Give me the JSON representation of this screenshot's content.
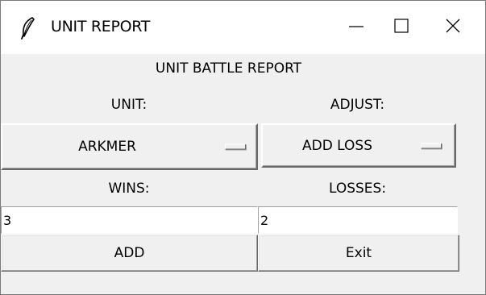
{
  "window": {
    "title": "UNIT REPORT",
    "icon": "feather-icon"
  },
  "controls": {
    "minimize_icon": "minimize-icon",
    "maximize_icon": "maximize-icon",
    "close_icon": "close-icon"
  },
  "header": {
    "title": "UNIT BATTLE REPORT"
  },
  "unit": {
    "label": "UNIT:",
    "selected": "ARKMER"
  },
  "adjust": {
    "label": "ADJUST:",
    "selected": "ADD LOSS"
  },
  "wins": {
    "label": "WINS:",
    "value": "3"
  },
  "losses": {
    "label": "LOSSES:",
    "value": "2"
  },
  "buttons": {
    "add_label": "ADD",
    "exit_label": "Exit"
  }
}
